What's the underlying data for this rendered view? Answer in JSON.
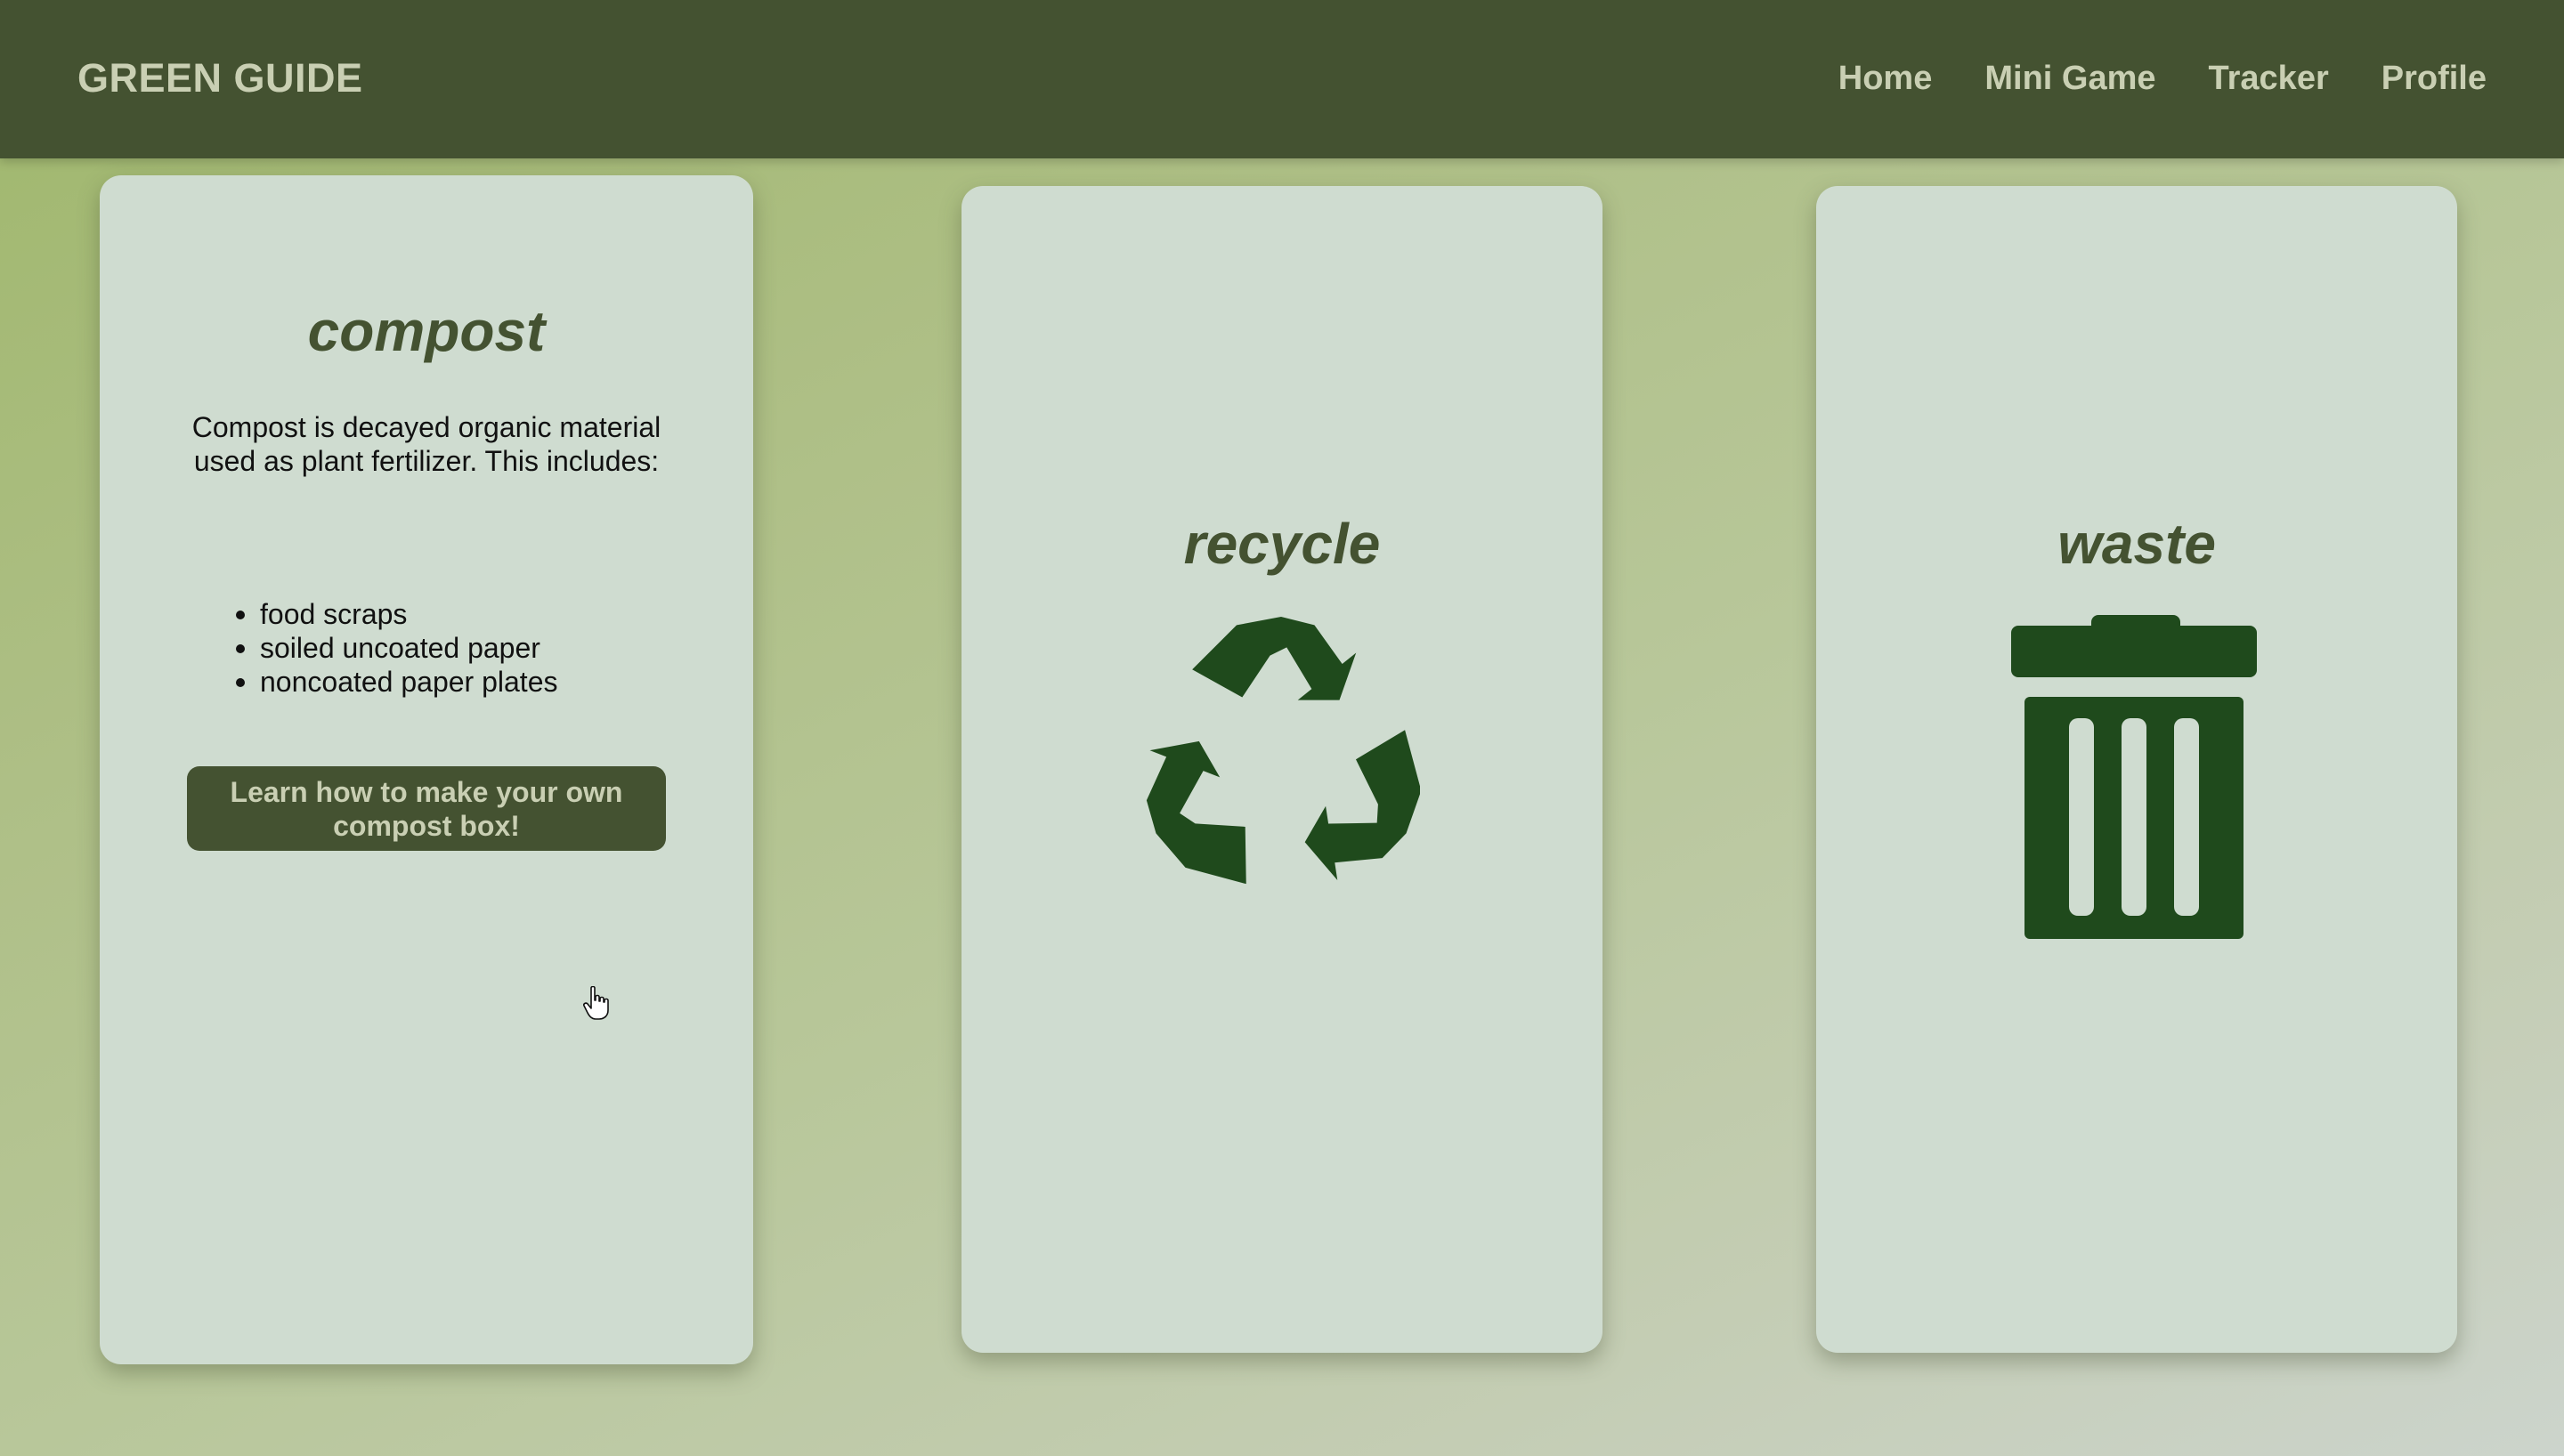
{
  "navbar": {
    "brand": "GREEN GUIDE",
    "links": [
      "Home",
      "Mini Game",
      "Tracker",
      "Profile"
    ]
  },
  "cards": {
    "compost": {
      "title": "compost",
      "description": "Compost is decayed organic material used as plant fertilizer. This includes:",
      "items": [
        "food scraps",
        "soiled uncoated paper",
        "noncoated paper plates"
      ],
      "button_label": "Learn how to make your own compost box!"
    },
    "recycle": {
      "title": "recycle",
      "icon": "recycle-icon"
    },
    "waste": {
      "title": "waste",
      "icon": "trash-can-icon"
    }
  },
  "colors": {
    "navbar_bg": "#445231",
    "nav_text": "#c9cfb3",
    "card_bg": "#cfdcd0",
    "title_color": "#445231",
    "icon_color": "#1f4a1c"
  }
}
